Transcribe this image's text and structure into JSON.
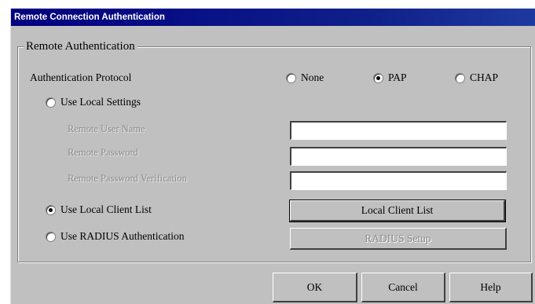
{
  "window": {
    "title": "Remote Connection Authentication"
  },
  "group": {
    "title": "Remote Authentication"
  },
  "protocol": {
    "label": "Authentication Protocol",
    "options": [
      {
        "label": "None",
        "checked": false
      },
      {
        "label": "PAP",
        "checked": true
      },
      {
        "label": "CHAP",
        "checked": false
      }
    ]
  },
  "local_settings": {
    "label": "Use Local Settings",
    "checked": false,
    "fields": {
      "user_name": {
        "label": "Remote User Name",
        "value": ""
      },
      "password": {
        "label": "Remote Password",
        "value": ""
      },
      "verify": {
        "label": "Remote Password Verification",
        "value": ""
      }
    }
  },
  "client_list": {
    "label": "Use Local Client List",
    "checked": true,
    "button": "Local Client List"
  },
  "radius": {
    "label": "Use RADIUS Authentication",
    "checked": false,
    "button": "RADIUS Setup"
  },
  "buttons": {
    "ok": "OK",
    "cancel": "Cancel",
    "help": "Help"
  }
}
